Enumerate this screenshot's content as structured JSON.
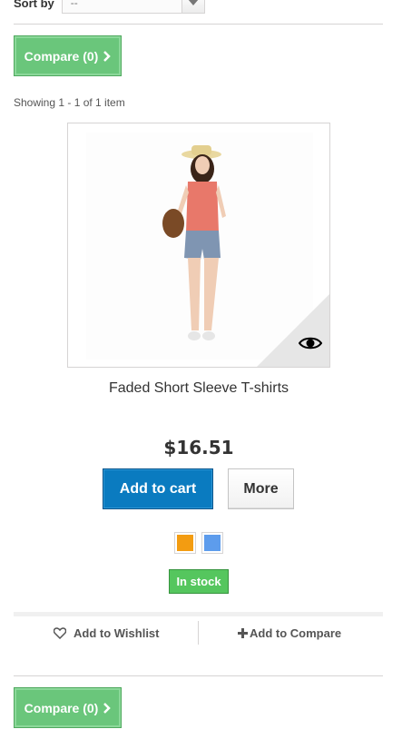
{
  "sort": {
    "label": "Sort by",
    "value": "--"
  },
  "compare": {
    "label": "Compare (0)"
  },
  "showing_text": "Showing 1 - 1 of 1 item",
  "product": {
    "name": "Faded Short Sleeve T-shirts",
    "price": "$16.51",
    "add_to_cart_label": "Add to cart",
    "more_label": "More",
    "colors": [
      "#f39c11",
      "#5d9cec"
    ],
    "availability": "In stock",
    "wishlist_label": "Add to Wishlist",
    "compare_label": "Add to Compare"
  }
}
